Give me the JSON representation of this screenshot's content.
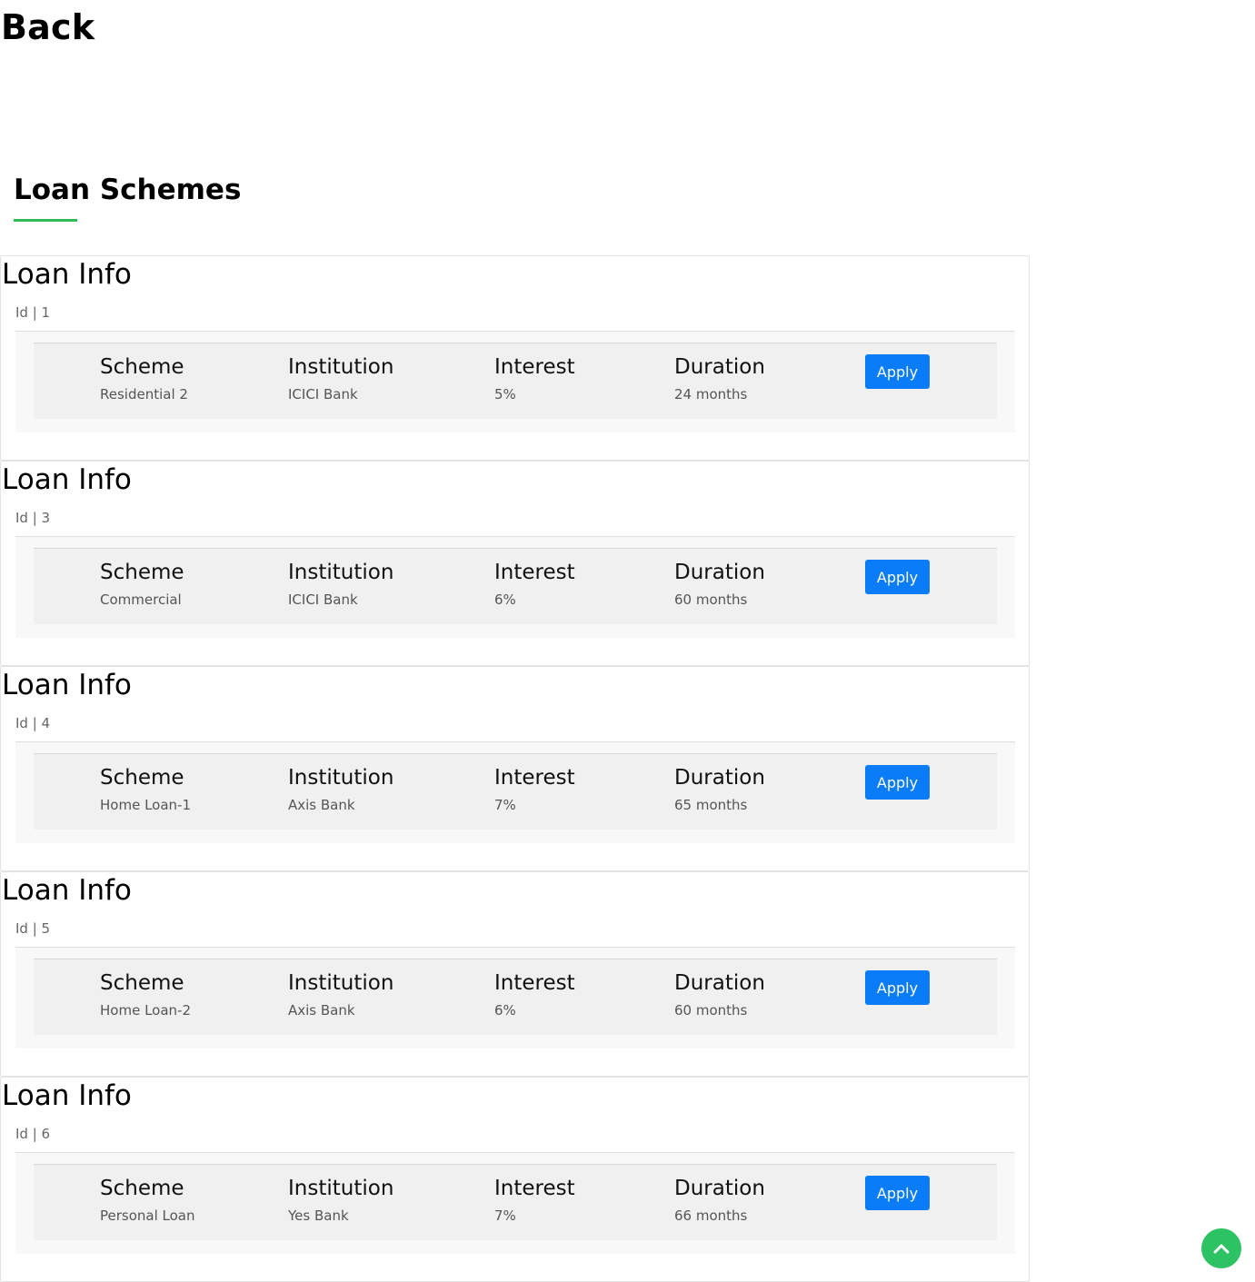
{
  "nav": {
    "back_label": "Back"
  },
  "section": {
    "title": "Loan Schemes",
    "accent_color": "#2fba55"
  },
  "labels": {
    "card_title": "Loan Info",
    "scheme": "Scheme",
    "institution": "Institution",
    "interest": "Interest",
    "duration": "Duration",
    "apply": "Apply"
  },
  "loans": [
    {
      "id_text": "Id | 1",
      "scheme": "Residential 2",
      "institution": "ICICI Bank",
      "interest": "5%",
      "duration": "24 months"
    },
    {
      "id_text": "Id | 3",
      "scheme": "Commercial",
      "institution": "ICICI Bank",
      "interest": "6%",
      "duration": "60 months"
    },
    {
      "id_text": "Id | 4",
      "scheme": "Home Loan-1",
      "institution": "Axis Bank",
      "interest": "7%",
      "duration": "65 months"
    },
    {
      "id_text": "Id | 5",
      "scheme": "Home Loan-2",
      "institution": "Axis Bank",
      "interest": "6%",
      "duration": "60 months"
    },
    {
      "id_text": "Id | 6",
      "scheme": "Personal Loan",
      "institution": "Yes Bank",
      "interest": "7%",
      "duration": "66 months"
    }
  ],
  "colors": {
    "apply_button": "#0a7cf7",
    "scroll_top_button": "#2dc263"
  },
  "icons": {
    "scroll_top": "chevron-up-icon"
  }
}
